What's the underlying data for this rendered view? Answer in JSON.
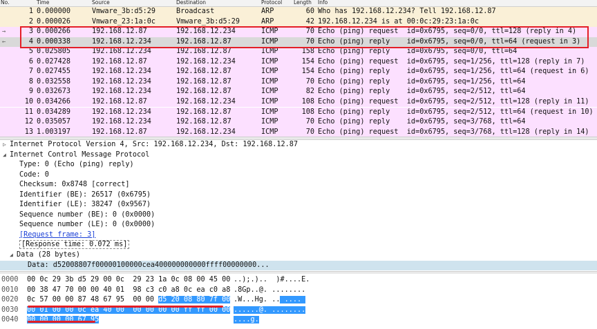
{
  "columns": [
    "No.",
    "Time",
    "Source",
    "Destination",
    "Protocol",
    "Length",
    "Info"
  ],
  "packets": [
    {
      "no": "1",
      "time": "0.000000",
      "src": "Vmware_3b:d5:29",
      "dst": "Broadcast",
      "proto": "ARP",
      "len": "60",
      "info": "Who has 192.168.12.234? Tell 192.168.12.87",
      "bg": "#faf0d7",
      "mark": ""
    },
    {
      "no": "2",
      "time": "0.000026",
      "src": "Vmware_23:1a:0c",
      "dst": "Vmware_3b:d5:29",
      "proto": "ARP",
      "len": "42",
      "info": "192.168.12.234 is at 00:0c:29:23:1a:0c",
      "bg": "#faf0d7",
      "mark": ""
    },
    {
      "no": "3",
      "time": "0.000266",
      "src": "192.168.12.87",
      "dst": "192.168.12.234",
      "proto": "ICMP",
      "len": "70",
      "info": "Echo (ping) request  id=0x6795, seq=0/0, ttl=128 (reply in 4)",
      "bg": "#fce0ff",
      "mark": "→"
    },
    {
      "no": "4",
      "time": "0.000338",
      "src": "192.168.12.234",
      "dst": "192.168.12.87",
      "proto": "ICMP",
      "len": "70",
      "info": "Echo (ping) reply    id=0x6795, seq=0/0, ttl=64 (request in 3)",
      "bg": "#d9d9d9",
      "mark": "←"
    },
    {
      "no": "5",
      "time": "0.025805",
      "src": "192.168.12.234",
      "dst": "192.168.12.87",
      "proto": "ICMP",
      "len": "158",
      "info": "Echo (ping) reply    id=0x6795, seq=0/0, ttl=64",
      "bg": "#fce0ff",
      "mark": ""
    },
    {
      "no": "6",
      "time": "0.027428",
      "src": "192.168.12.87",
      "dst": "192.168.12.234",
      "proto": "ICMP",
      "len": "154",
      "info": "Echo (ping) request  id=0x6795, seq=1/256, ttl=128 (reply in 7)",
      "bg": "#fce0ff",
      "mark": ""
    },
    {
      "no": "7",
      "time": "0.027455",
      "src": "192.168.12.234",
      "dst": "192.168.12.87",
      "proto": "ICMP",
      "len": "154",
      "info": "Echo (ping) reply    id=0x6795, seq=1/256, ttl=64 (request in 6)",
      "bg": "#fce0ff",
      "mark": ""
    },
    {
      "no": "8",
      "time": "0.032558",
      "src": "192.168.12.234",
      "dst": "192.168.12.87",
      "proto": "ICMP",
      "len": "70",
      "info": "Echo (ping) reply    id=0x6795, seq=1/256, ttl=64",
      "bg": "#fce0ff",
      "mark": ""
    },
    {
      "no": "9",
      "time": "0.032673",
      "src": "192.168.12.234",
      "dst": "192.168.12.87",
      "proto": "ICMP",
      "len": "82",
      "info": "Echo (ping) reply    id=0x6795, seq=2/512, ttl=64",
      "bg": "#fce0ff",
      "mark": ""
    },
    {
      "no": "10",
      "time": "0.034266",
      "src": "192.168.12.87",
      "dst": "192.168.12.234",
      "proto": "ICMP",
      "len": "108",
      "info": "Echo (ping) request  id=0x6795, seq=2/512, ttl=128 (reply in 11)",
      "bg": "#fce0ff",
      "mark": ""
    },
    {
      "no": "11",
      "time": "0.034289",
      "src": "192.168.12.234",
      "dst": "192.168.12.87",
      "proto": "ICMP",
      "len": "108",
      "info": "Echo (ping) reply    id=0x6795, seq=2/512, ttl=64 (request in 10)",
      "bg": "#fce0ff",
      "mark": ""
    },
    {
      "no": "12",
      "time": "0.035057",
      "src": "192.168.12.234",
      "dst": "192.168.12.87",
      "proto": "ICMP",
      "len": "70",
      "info": "Echo (ping) reply    id=0x6795, seq=3/768, ttl=64",
      "bg": "#fce0ff",
      "mark": ""
    },
    {
      "no": "13",
      "time": "1.003197",
      "src": "192.168.12.87",
      "dst": "192.168.12.234",
      "proto": "ICMP",
      "len": "70",
      "info": "Echo (ping) request  id=0x6795, seq=3/768, ttl=128 (reply in 14)",
      "bg": "#fce0ff",
      "mark": ""
    }
  ],
  "details": {
    "ip_line": "Internet Protocol Version 4, Src: 192.168.12.234, Dst: 192.168.12.87",
    "icmp_line": "Internet Control Message Protocol",
    "fields": [
      "Type: 0 (Echo (ping) reply)",
      "Code: 0",
      "Checksum: 0x8748 [correct]",
      "Identifier (BE): 26517 (0x6795)",
      "Identifier (LE): 38247 (0x9567)",
      "Sequence number (BE): 0 (0x0000)",
      "Sequence number (LE): 0 (0x0000)"
    ],
    "request_frame": "[Request frame: 3]",
    "response_time": "[Response time: 0.072 ms]",
    "data_line": "Data (28 bytes)",
    "data_value": "Data: d52008807f00000100000cea400000000000ffff00000000..."
  },
  "hex": [
    {
      "off": "0000",
      "pre": "00 0c 29 3b d5 29 00 0c  29 23 1a 0c 08 00 45 00",
      "sel": "",
      "ascii_pre": "..);.)..  )#....E.",
      "ascii_sel": ""
    },
    {
      "off": "0010",
      "pre": "00 38 47 70 00 00 40 01  98 c3 c0 a8 0c ea c0 a8",
      "sel": "",
      "ascii_pre": ".8Gp..@. ........",
      "ascii_sel": ""
    },
    {
      "off": "0020",
      "pre": "0c 57 00 00 87 48 67 95  00 00 ",
      "sel": "d5 20 08 80 7f 00",
      "ascii_pre": ".W...Hg. ..",
      "ascii_sel": " .... "
    },
    {
      "off": "0030",
      "pre": "",
      "sel": "00 01 00 00 0c ea 40 00  00 00 00 00 ff ff 00 00",
      "ascii_pre": "",
      "ascii_sel": "......@. ........"
    },
    {
      "off": "0040",
      "pre": "",
      "sel": "00 00 00 00 67 95",
      "ascii_pre": "",
      "ascii_sel": "....g."
    }
  ],
  "colors": {
    "icmp": "#fce0ff",
    "arp": "#faf0d7",
    "selected": "#d9d9d9",
    "highlight": "#e41e26",
    "hex_selection": "#3399ff"
  }
}
